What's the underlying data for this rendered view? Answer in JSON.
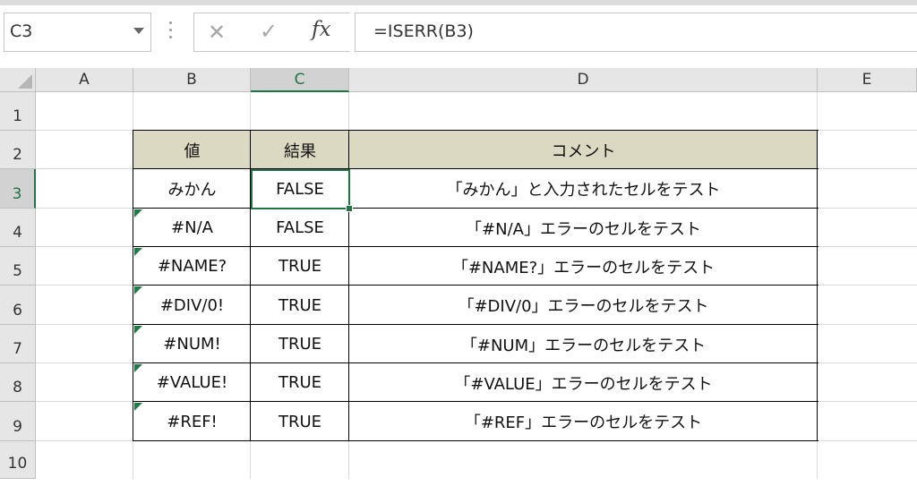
{
  "name_box": {
    "value": "C3"
  },
  "formula_bar": {
    "cancel_icon": "✕",
    "enter_icon": "✓",
    "fx_label": "fx",
    "formula": "=ISERR(B3)"
  },
  "columns": [
    "A",
    "B",
    "C",
    "D",
    "E"
  ],
  "rows": [
    "1",
    "2",
    "3",
    "4",
    "5",
    "6",
    "7",
    "8",
    "9",
    "10"
  ],
  "selected_cell": "C3",
  "colors": {
    "accent": "#217346",
    "header_fill": "#dcd9c2",
    "error_indicator": "#1f7a45"
  },
  "table": {
    "headers": [
      "値",
      "結果",
      "コメント"
    ],
    "rows": [
      {
        "value": "みかん",
        "result": "FALSE",
        "comment": "「みかん」と入力されたセルをテスト"
      },
      {
        "value": "#N/A",
        "result": "FALSE",
        "comment": "「#N/A」エラーのセルをテスト"
      },
      {
        "value": "#NAME?",
        "result": "TRUE",
        "comment": "「#NAME?」エラーのセルをテスト"
      },
      {
        "value": "#DIV/0!",
        "result": "TRUE",
        "comment": "「#DIV/0」エラーのセルをテスト"
      },
      {
        "value": "#NUM!",
        "result": "TRUE",
        "comment": "「#NUM」エラーのセルをテスト"
      },
      {
        "value": "#VALUE!",
        "result": "TRUE",
        "comment": "「#VALUE」エラーのセルをテスト"
      },
      {
        "value": "#REF!",
        "result": "TRUE",
        "comment": "「#REF」エラーのセルをテスト"
      }
    ]
  }
}
